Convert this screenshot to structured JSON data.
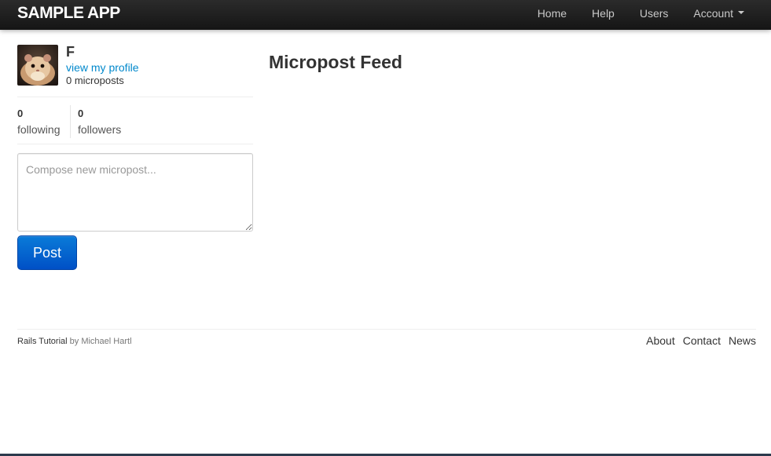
{
  "navbar": {
    "brand": "SAMPLE APP",
    "links": {
      "home": "Home",
      "help": "Help",
      "users": "Users",
      "account": "Account"
    }
  },
  "sidebar": {
    "user_name": "F",
    "profile_link": "view my profile",
    "microposts_count": "0 microposts",
    "stats": {
      "following_count": "0",
      "following_label": "following",
      "followers_count": "0",
      "followers_label": "followers"
    },
    "compose": {
      "placeholder": "Compose new micropost...",
      "value": ""
    },
    "post_button": "Post"
  },
  "main": {
    "title": "Micropost Feed"
  },
  "footer": {
    "credit_link": "Rails Tutorial",
    "credit_by": "by",
    "credit_author": "Michael Hartl",
    "links": {
      "about": "About",
      "contact": "Contact",
      "news": "News"
    }
  },
  "colors": {
    "link": "#0088cc",
    "navbar": "#1b1b1b",
    "button": "#0062cc"
  },
  "icons": {
    "avatar": "hamster-avatar-image",
    "account_dropdown": "caret-down-icon"
  }
}
